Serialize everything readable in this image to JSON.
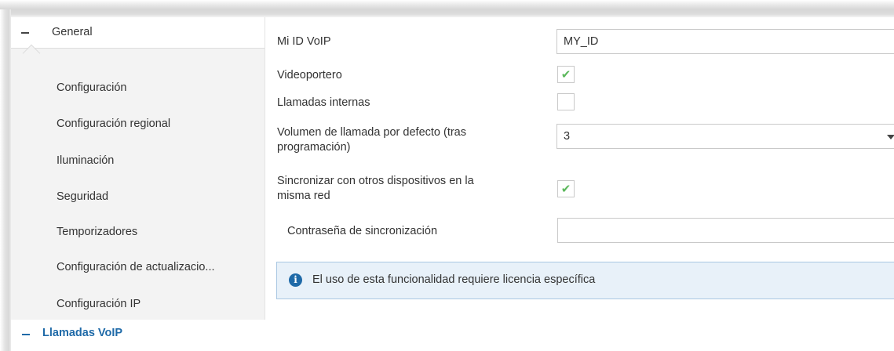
{
  "sidebar": {
    "general_label": "General",
    "items": [
      {
        "label": "Configuración"
      },
      {
        "label": "Configuración regional"
      },
      {
        "label": "Iluminación"
      },
      {
        "label": "Seguridad"
      },
      {
        "label": "Temporizadores"
      },
      {
        "label": "Configuración de actualizacio..."
      },
      {
        "label": "Configuración IP"
      }
    ],
    "active_section": "Llamadas VoIP"
  },
  "form": {
    "voip_id": {
      "label": "Mi ID VoIP",
      "value": "MY_ID"
    },
    "videoportero": {
      "label": "Videoportero",
      "checked": true
    },
    "llamadas_internas": {
      "label": "Llamadas internas",
      "checked": false
    },
    "volumen": {
      "label_line1": "Volumen de llamada por defecto (tras",
      "label_line2": "programación)",
      "value": "3"
    },
    "sincronizar": {
      "label_line1": "Sincronizar con otros dispositivos en la",
      "label_line2": "misma red",
      "checked": true
    },
    "contrasena": {
      "label": "Contraseña de sincronización",
      "value": ""
    }
  },
  "info": {
    "text": "El uso de esta funcionalidad requiere licencia específica"
  },
  "colors": {
    "accent": "#1f6aa8",
    "check": "#5cb85c",
    "info_bg": "#e8f1f9"
  }
}
